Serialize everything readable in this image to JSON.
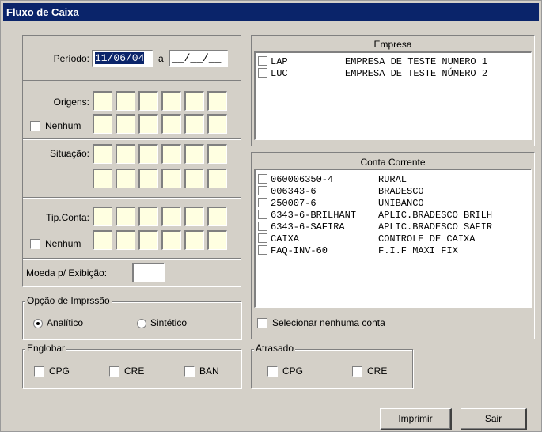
{
  "window": {
    "title": "Fluxo de Caixa"
  },
  "filters": {
    "periodo_label": "Período:",
    "periodo_from": "11/06/04",
    "periodo_sep": "a",
    "periodo_to": "__/__/__",
    "origens_label": "Origens:",
    "origens_nenhum": "Nenhum",
    "situacao_label": "Situação:",
    "tipconta_label": "Tip.Conta:",
    "tipconta_nenhum": "Nenhum",
    "moeda_label": "Moeda p/ Exibição:",
    "moeda_value": ""
  },
  "opcao_impressao": {
    "title": "Opção de Imprssão",
    "analitico": "Analítico",
    "sintetico": "Sintético",
    "selected": "Analítico"
  },
  "englobar": {
    "title": "Englobar",
    "items": [
      "CPG",
      "CRE",
      "BAN"
    ]
  },
  "atrasado": {
    "title": "Atrasado",
    "items": [
      "CPG",
      "CRE"
    ]
  },
  "empresa": {
    "title": "Empresa",
    "rows": [
      {
        "code": "LAP",
        "name": "EMPRESA DE TESTE NUMERO 1"
      },
      {
        "code": "LUC",
        "name": "EMPRESA DE TESTE NÚMERO 2"
      }
    ]
  },
  "conta_corrente": {
    "title": "Conta Corrente",
    "rows": [
      {
        "code": "060006350-4",
        "name": "RURAL"
      },
      {
        "code": "006343-6",
        "name": "BRADESCO"
      },
      {
        "code": "250007-6",
        "name": "UNIBANCO"
      },
      {
        "code": "6343-6-BRILHANT",
        "name": "APLIC.BRADESCO BRILH"
      },
      {
        "code": "6343-6-SAFIRA",
        "name": "APLIC.BRADESCO SAFIR"
      },
      {
        "code": "CAIXA",
        "name": "CONTROLE DE CAIXA"
      },
      {
        "code": "FAQ-INV-60",
        "name": "F.I.F MAXI FIX"
      }
    ],
    "selecionar_nenhuma": "Selecionar nenhuma conta"
  },
  "buttons": {
    "imprimir_u": "I",
    "imprimir_rest": "mprimir",
    "sair_u": "S",
    "sair_rest": "air"
  }
}
